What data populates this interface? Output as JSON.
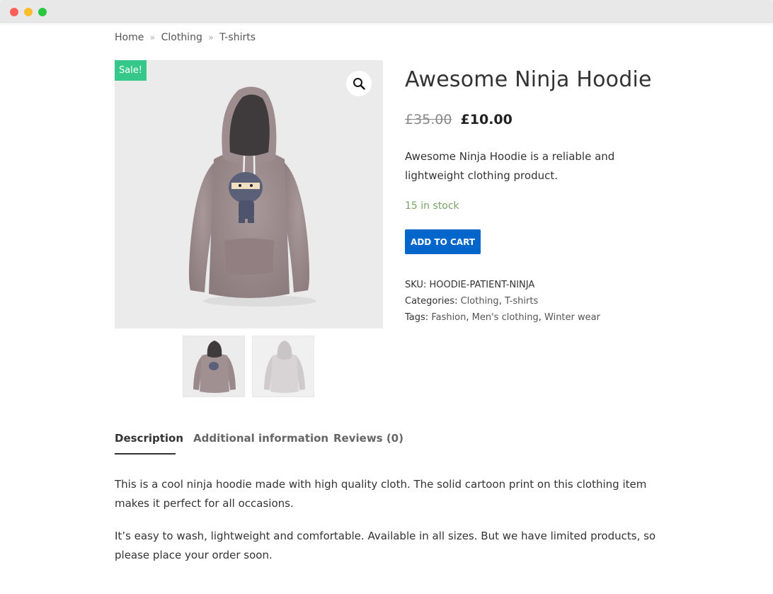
{
  "breadcrumb": {
    "home": "Home",
    "sep": "»",
    "clothing": "Clothing",
    "tshirts": "T-shirts"
  },
  "gallery": {
    "sale_badge": "Sale!",
    "zoom_icon": "magnifier-icon",
    "thumbnails": [
      "front view",
      "back view"
    ]
  },
  "product": {
    "title": "Awesome Ninja Hoodie",
    "old_price": "£35.00",
    "new_price": "£10.00",
    "short_description": "Awesome Ninja Hoodie is a reliable and lightweight clothing product.",
    "stock": "15 in stock",
    "add_to_cart": "ADD TO CART",
    "sku_label": "SKU:",
    "sku": "HOODIE-PATIENT-NINJA",
    "categories_label": "Categories:",
    "categories": [
      "Clothing",
      "T-shirts"
    ],
    "tags_label": "Tags:",
    "tags": [
      "Fashion",
      "Men's clothing",
      "Winter wear"
    ]
  },
  "tabs": {
    "description": "Description",
    "additional": "Additional information",
    "reviews": "Reviews (0)"
  },
  "description": {
    "p1": "This is a cool ninja hoodie made with high quality cloth. The solid cartoon print on this clothing item makes it perfect for all occasions.",
    "p2": "It’s easy to wash, lightweight and comfortable. Available in all sizes. But we have limited products, so please place your order soon."
  },
  "colors": {
    "sale_badge": "#36c88a",
    "button": "#0066cc",
    "stock": "#77a464"
  }
}
